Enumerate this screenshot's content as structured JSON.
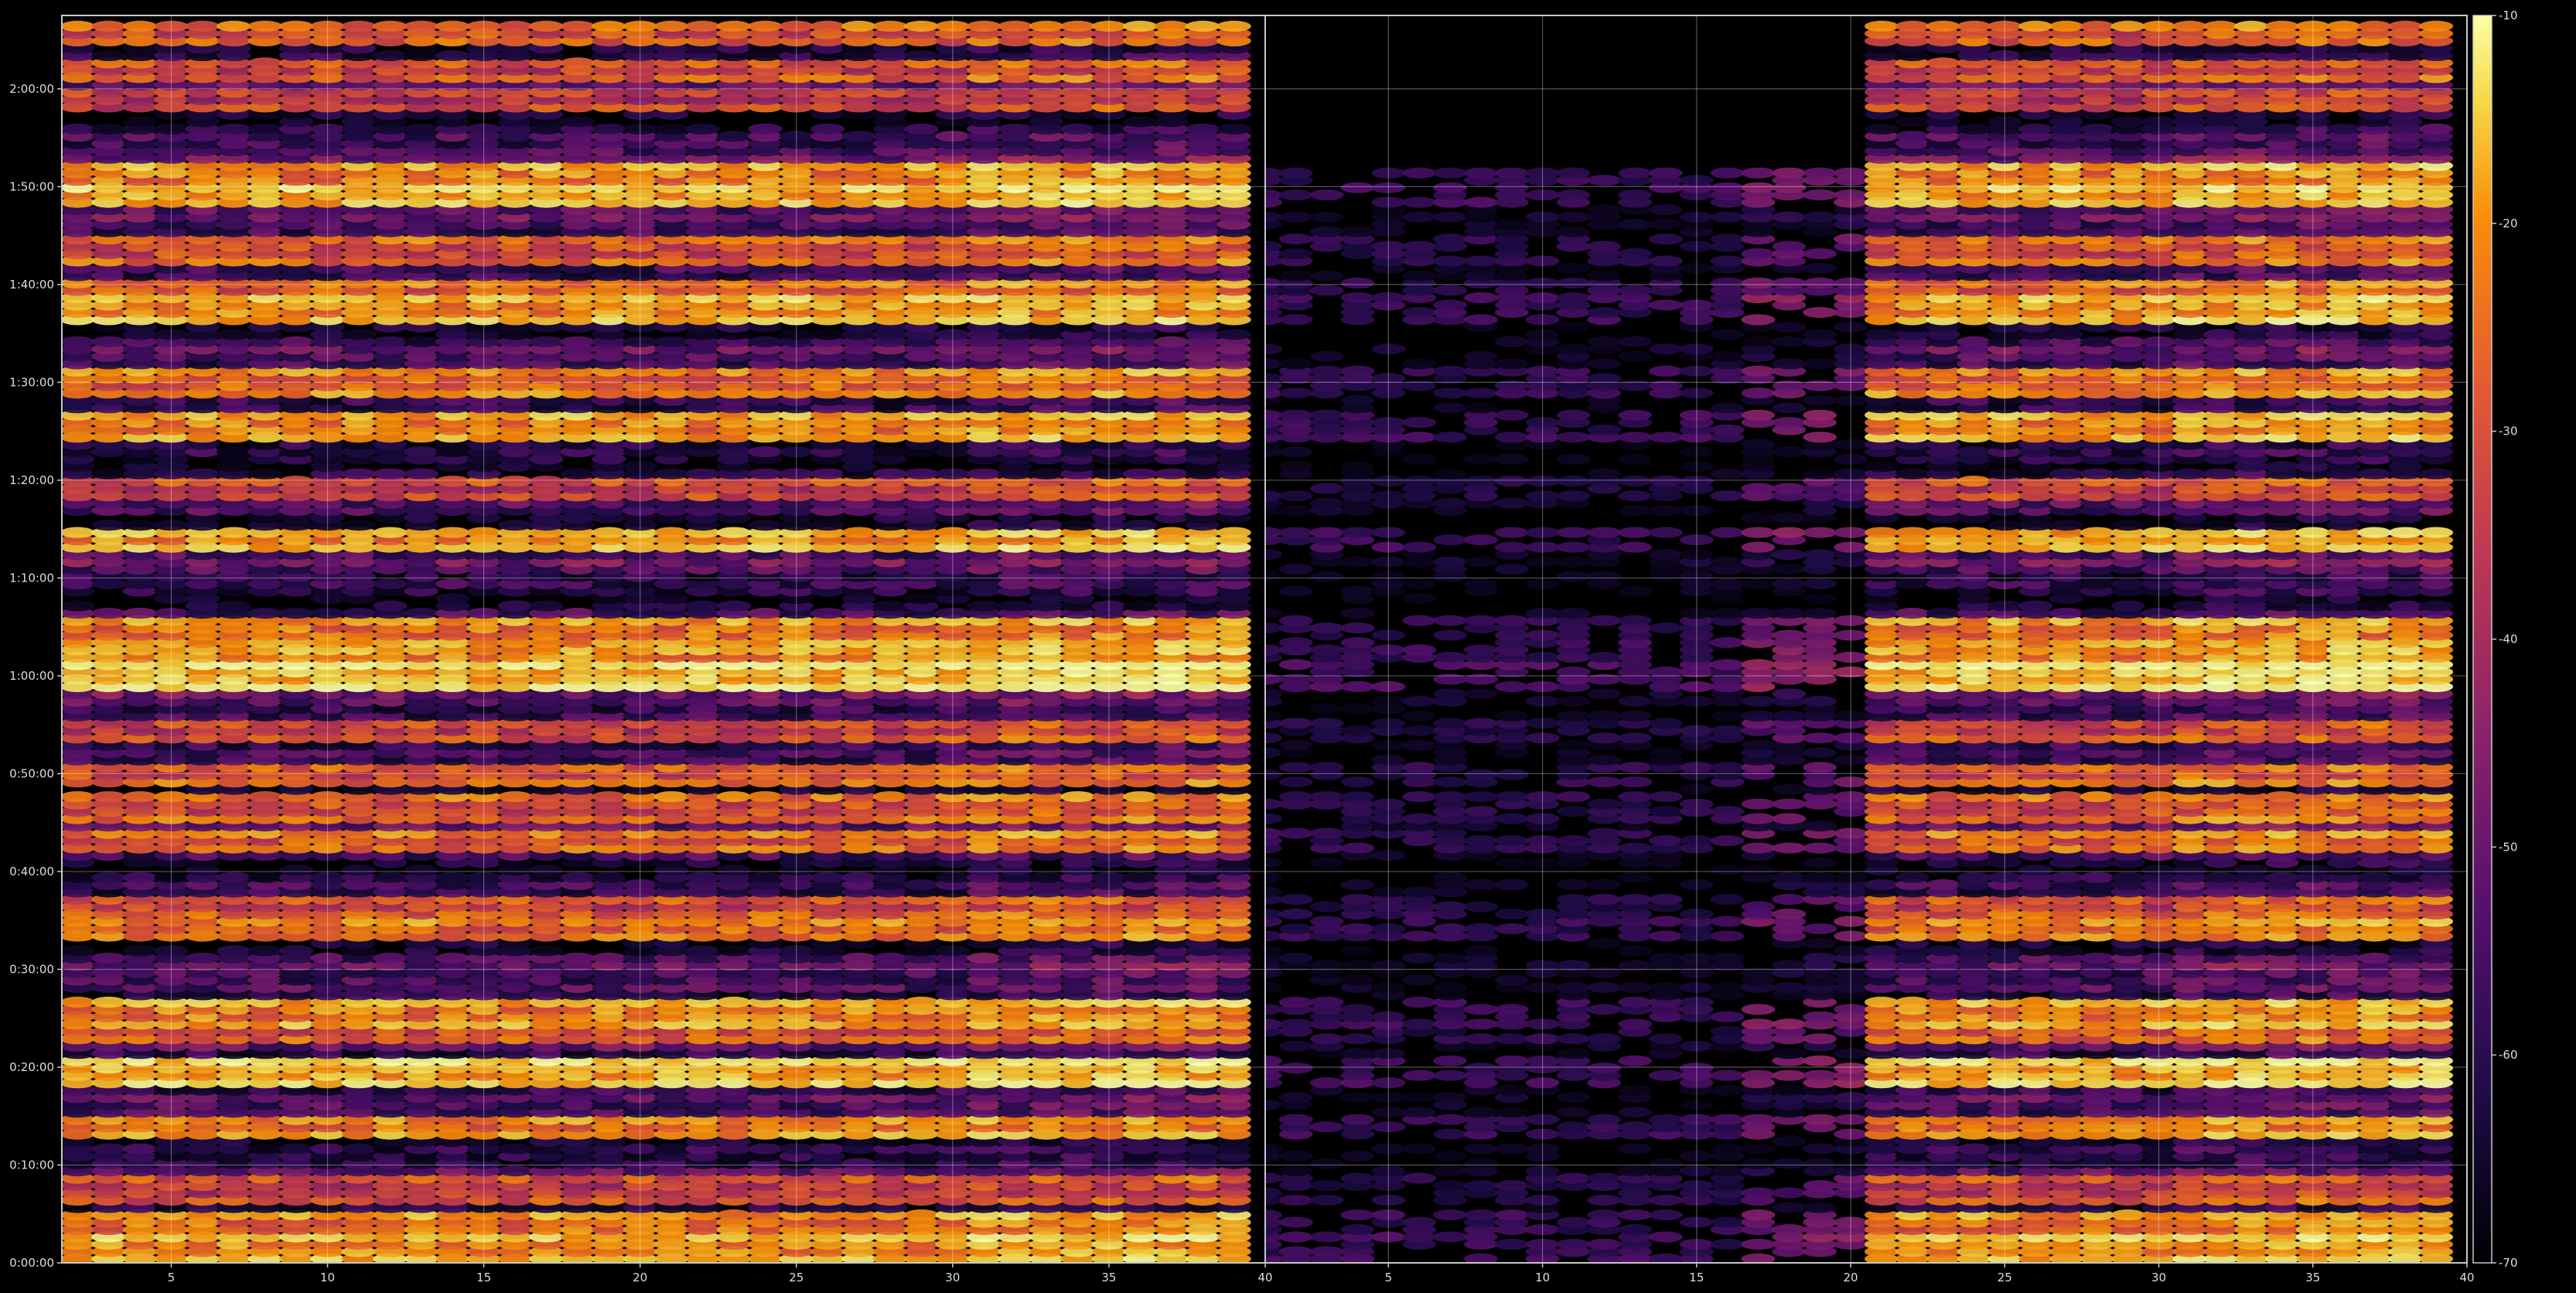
{
  "chart_data": {
    "type": "heatmap",
    "colormap": "inferno",
    "background": "#000000",
    "grid": true,
    "panels": [
      {
        "name": "",
        "x_range": [
          1.5,
          40
        ],
        "x_ticks": [
          "5",
          "10",
          "15",
          "20",
          "25",
          "30",
          "35",
          "40"
        ],
        "coverage": [
          [
            1.5,
            39.6,
            0.0,
            126.5
          ]
        ]
      },
      {
        "name": "",
        "x_range": [
          1,
          40
        ],
        "x_ticks": [
          "5",
          "10",
          "15",
          "20",
          "25",
          "30",
          "35",
          "40"
        ],
        "coverage": [
          [
            21,
            39.6,
            0.0,
            126.5
          ],
          [
            17,
            21,
            0.0,
            112.0
          ],
          [
            1,
            17,
            0.0,
            112.0
          ]
        ],
        "sparse_below_x": 21
      }
    ],
    "y_axis": {
      "range": [
        0,
        127.5
      ],
      "unit": "minutes",
      "ticks": [
        "0:00:00",
        "0:10:00",
        "0:20:00",
        "0:30:00",
        "0:40:00",
        "0:50:00",
        "1:00:00",
        "1:10:00",
        "1:20:00",
        "1:30:00",
        "1:40:00",
        "1:50:00",
        "2:00:00"
      ]
    },
    "colorbar": {
      "range": [
        -70,
        -10
      ],
      "ticks": [
        "-10",
        "-20",
        "-30",
        "-40",
        "-50",
        "-60",
        "-70"
      ]
    },
    "strong_rows": [
      {
        "t": 1.5,
        "v": -28
      },
      {
        "t": 3.8,
        "v": -32
      },
      {
        "t": 7.5,
        "v": -42
      },
      {
        "t": 14.0,
        "v": -30
      },
      {
        "t": 19.5,
        "v": -25
      },
      {
        "t": 23.5,
        "v": -35
      },
      {
        "t": 25.5,
        "v": -30
      },
      {
        "t": 34.0,
        "v": -32
      },
      {
        "t": 36.5,
        "v": -38
      },
      {
        "t": 43.0,
        "v": -34
      },
      {
        "t": 46.5,
        "v": -38
      },
      {
        "t": 50.0,
        "v": -36
      },
      {
        "t": 54.5,
        "v": -40
      },
      {
        "t": 60.0,
        "v": -22
      },
      {
        "t": 62.0,
        "v": -27
      },
      {
        "t": 64.5,
        "v": -32
      },
      {
        "t": 74.0,
        "v": -26
      },
      {
        "t": 79.0,
        "v": -40
      },
      {
        "t": 85.5,
        "v": -30
      },
      {
        "t": 90.0,
        "v": -34
      },
      {
        "t": 97.5,
        "v": -28
      },
      {
        "t": 99.5,
        "v": -33
      },
      {
        "t": 103.5,
        "v": -38
      },
      {
        "t": 109.0,
        "v": -24
      },
      {
        "t": 111.0,
        "v": -30
      },
      {
        "t": 119.0,
        "v": -42
      },
      {
        "t": 122.0,
        "v": -38
      },
      {
        "t": 125.5,
        "v": -36
      }
    ]
  }
}
